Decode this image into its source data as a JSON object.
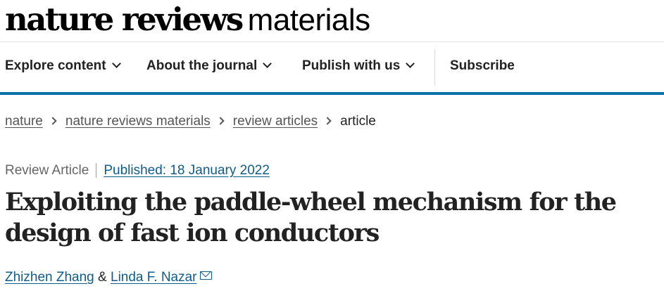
{
  "masthead": {
    "logo_bold": "nature reviews",
    "logo_light": "materials"
  },
  "nav": {
    "items": [
      {
        "label": "Explore content",
        "has_dropdown": true
      },
      {
        "label": "About the journal",
        "has_dropdown": true
      },
      {
        "label": "Publish with us",
        "has_dropdown": true
      },
      {
        "label": "Subscribe",
        "has_dropdown": false
      }
    ],
    "accent_color": "#0070a8"
  },
  "breadcrumb": {
    "items": [
      "nature",
      "nature reviews materials",
      "review articles"
    ],
    "current": "article"
  },
  "article": {
    "type": "Review Article",
    "published": "Published: 18 January 2022",
    "title": "Exploiting the paddle-wheel mechanism for the design of fast ion conductors",
    "authors": [
      "Zhizhen Zhang",
      "Linda F. Nazar"
    ],
    "author_joiner": "&",
    "corresponding_icon": "mail-icon"
  }
}
